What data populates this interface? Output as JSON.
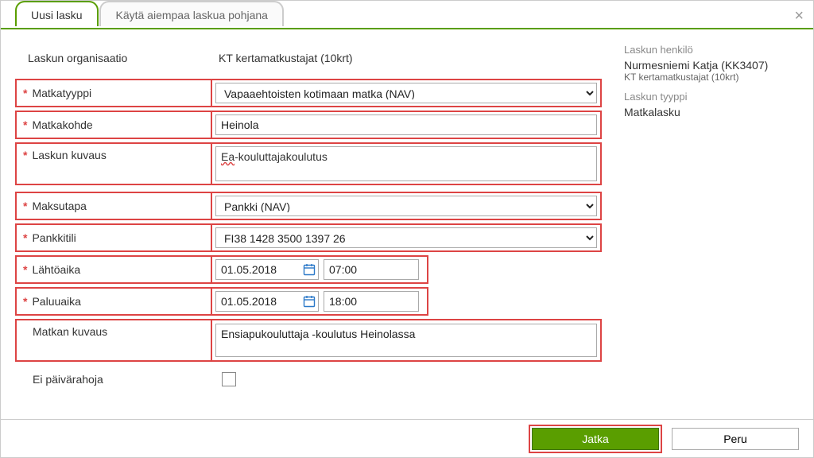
{
  "tabs": {
    "new": "Uusi lasku",
    "template": "Käytä aiempaa laskua pohjana"
  },
  "labels": {
    "org": "Laskun organisaatio",
    "triptype": "Matkatyyppi",
    "destination": "Matkakohde",
    "description": "Laskun kuvaus",
    "paymethod": "Maksutapa",
    "bankacct": "Pankkitili",
    "depart": "Lähtöaika",
    "return": "Paluuaika",
    "tripdesc": "Matkan kuvaus",
    "noperdiem": "Ei päivärahoja"
  },
  "values": {
    "org": "KT kertamatkustajat (10krt)",
    "triptype": "Vapaaehtoisten kotimaan matka (NAV)",
    "destination": "Heinola",
    "description_prefix": "Ea",
    "description_rest": "-kouluttajakoulutus",
    "paymethod": "Pankki (NAV)",
    "bankacct": "FI38 1428 3500 1397 26",
    "depart_date": "01.05.2018",
    "depart_time": "07:00",
    "return_date": "01.05.2018",
    "return_time": "18:00",
    "tripdesc": "Ensiapukouluttaja -koulutus Heinolassa"
  },
  "side": {
    "person_heading": "Laskun henkilö",
    "person_name": "Nurmesniemi Katja (KK3407)",
    "person_org": "KT kertamatkustajat (10krt)",
    "type_heading": "Laskun tyyppi",
    "type_val": "Matkalasku"
  },
  "footer": {
    "continue": "Jatka",
    "cancel": "Peru"
  }
}
